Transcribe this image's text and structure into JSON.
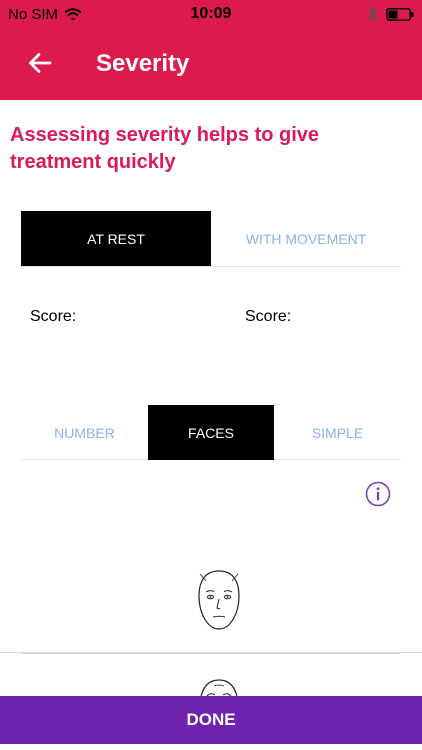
{
  "status_bar": {
    "carrier": "No SIM",
    "time": "10:09"
  },
  "app_bar": {
    "title": "Severity",
    "back_icon": "arrow-left-icon"
  },
  "headline": "Assessing severity helps to give treatment quickly",
  "condition_tabs": [
    {
      "label": "AT REST",
      "active": true
    },
    {
      "label": "WITH MOVEMENT",
      "active": false
    }
  ],
  "scores": {
    "left_label": "Score:",
    "right_label": "Score:"
  },
  "scale_tabs": [
    {
      "label": "NUMBER",
      "active": false
    },
    {
      "label": "FACES",
      "active": true
    },
    {
      "label": "SIMPLE",
      "active": false
    }
  ],
  "info_icon": "info-circle-icon",
  "faces": [
    {
      "icon": "neutral-face-icon"
    },
    {
      "icon": "frown-face-icon"
    }
  ],
  "done_label": "DONE",
  "colors": {
    "app_bar": "#dc1a4c",
    "headline": "#dc1a5a",
    "tab_active_bg": "#000000",
    "tab_inactive_text": "#8ab3e6",
    "info": "#7a3fb5",
    "done_bg": "#6f22ae"
  }
}
